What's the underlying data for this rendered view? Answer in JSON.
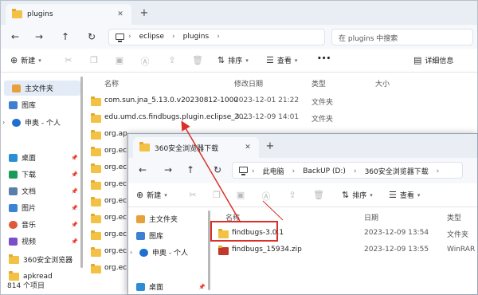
{
  "win1": {
    "tab_title": "plugins",
    "breadcrumb": [
      "eclipse",
      "plugins"
    ],
    "search_placeholder": "在 plugins 中搜索",
    "commands": {
      "new": "新建",
      "sort": "排序",
      "view": "查看",
      "more": "•••",
      "details": "详细信息"
    },
    "columns": {
      "name": "名称",
      "date": "修改日期",
      "type": "类型",
      "size": "大小"
    },
    "sidebar": [
      {
        "label": "主文件夹",
        "icon": "home-icon",
        "selected": true
      },
      {
        "label": "图库",
        "icon": "gallery-icon"
      },
      {
        "label": "申奥 - 个人",
        "icon": "cloud-icon",
        "expandable": true
      },
      {
        "label": "桌面",
        "icon": "desktop-icon",
        "pinned": true
      },
      {
        "label": "下载",
        "icon": "download-icon",
        "pinned": true
      },
      {
        "label": "文档",
        "icon": "document-icon",
        "pinned": true
      },
      {
        "label": "图片",
        "icon": "picture-icon",
        "pinned": true
      },
      {
        "label": "音乐",
        "icon": "music-icon",
        "pinned": true
      },
      {
        "label": "视频",
        "icon": "video-icon",
        "pinned": true
      },
      {
        "label": "360安全浏览器",
        "icon": "folder-icon"
      },
      {
        "label": "apkread",
        "icon": "folder-icon"
      }
    ],
    "files": [
      {
        "name": "com.sun.jna_5.13.0.v20230812-1000",
        "date": "2023-12-01 21:22",
        "type": "文件夹"
      },
      {
        "name": "edu.umd.cs.findbugs.plugin.eclipse_3....",
        "date": "2023-12-09 14:01",
        "type": "文件夹"
      },
      {
        "name": "org.ap"
      },
      {
        "name": "org.ec"
      },
      {
        "name": "org.ec"
      },
      {
        "name": "org.ec"
      },
      {
        "name": "org.ec"
      },
      {
        "name": "org.ec"
      },
      {
        "name": "org.ec"
      },
      {
        "name": "org.ec"
      },
      {
        "name": "org.ec"
      }
    ],
    "status": "814 个项目"
  },
  "win2": {
    "tab_title": "360安全浏览器下载",
    "breadcrumb": [
      "此电脑",
      "BackUP (D:)",
      "360安全浏览器下载"
    ],
    "commands": {
      "new": "新建",
      "sort": "排序",
      "view": "查看"
    },
    "columns": {
      "name": "名称",
      "date": "日期",
      "type": "类型"
    },
    "sidebar": [
      {
        "label": "主文件夹",
        "icon": "home-icon"
      },
      {
        "label": "图库",
        "icon": "gallery-icon"
      },
      {
        "label": "申奥 - 个人",
        "icon": "cloud-icon",
        "expandable": true
      },
      {
        "label": "桌面",
        "icon": "desktop-icon",
        "pinned": true
      }
    ],
    "files": [
      {
        "name": "findbugs-3.0.1",
        "date": "2023-12-09 13:54",
        "type": "文件夹",
        "icon": "folder-icon"
      },
      {
        "name": "findbugs_15934.zip",
        "date": "2023-12-09 13:55",
        "type": "WinRAR Z",
        "icon": "zip-icon"
      }
    ]
  },
  "colors": {
    "highlight": "#d9302b",
    "folder": "#f3c244",
    "selected": "#e3ebf6"
  }
}
